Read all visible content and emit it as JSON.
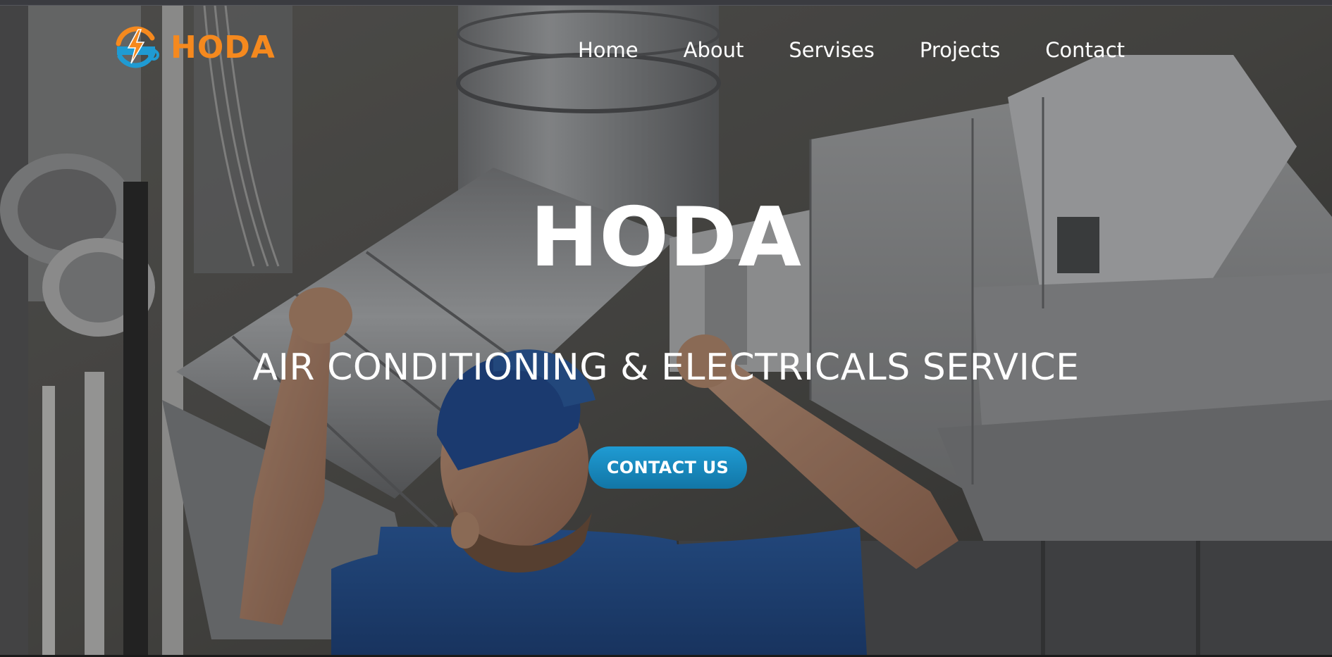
{
  "brand": {
    "name": "HODA",
    "logo_icon": "lightning-wrench-icon",
    "accent_color": "#f5891e",
    "secondary_color": "#1f9bd3"
  },
  "nav": {
    "items": [
      {
        "label": "Home"
      },
      {
        "label": "About"
      },
      {
        "label": "Servises"
      },
      {
        "label": "Projects"
      },
      {
        "label": "Contact"
      }
    ]
  },
  "hero": {
    "title": "HODA",
    "subtitle": "AIR CONDITIONING & ELECTRICALS SERVICE",
    "cta_label": "CONTACT US",
    "cta_color": "#1f9bd3",
    "background_image": "technician-installing-ductwork-photo"
  }
}
